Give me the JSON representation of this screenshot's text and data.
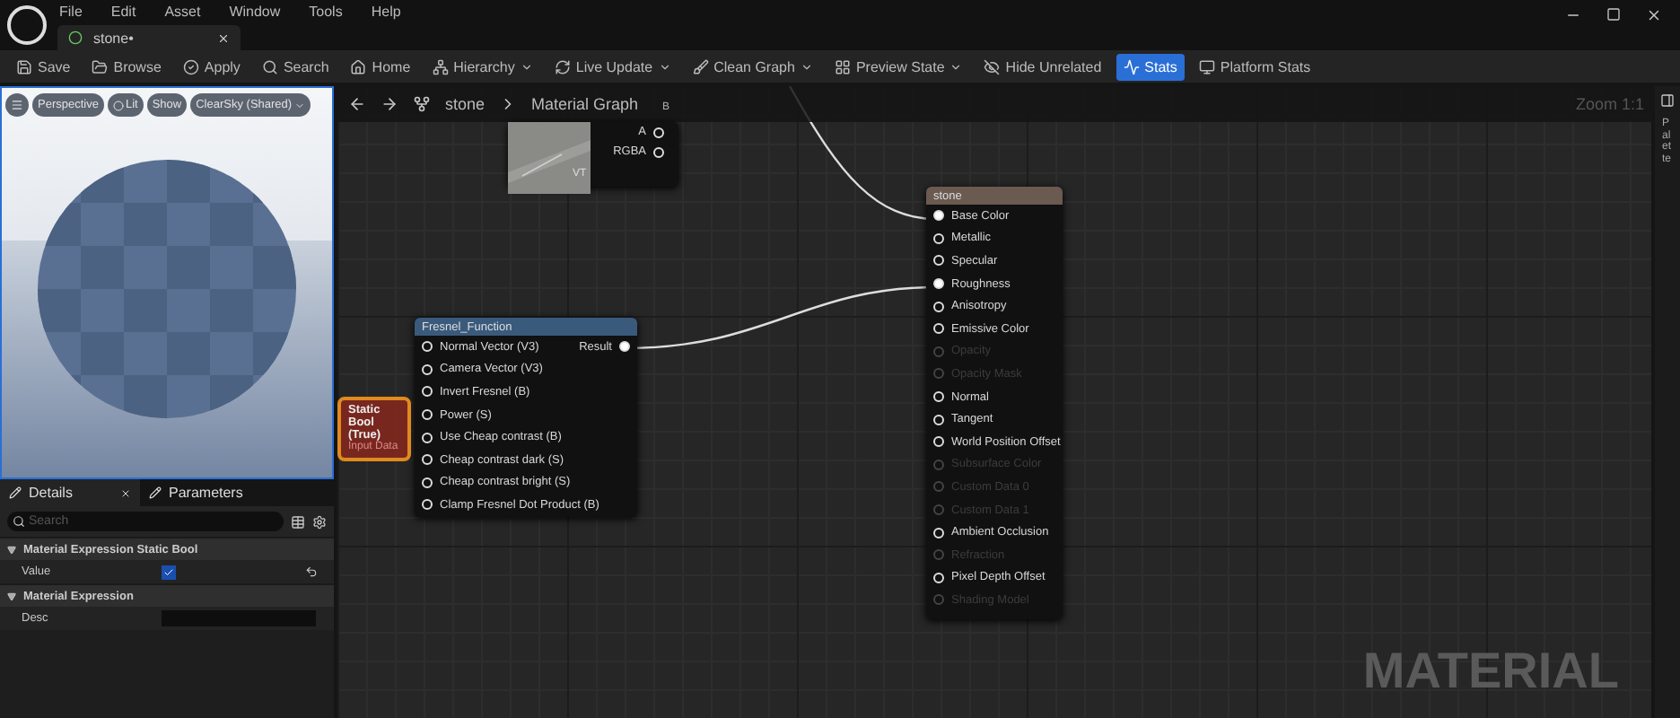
{
  "menu": [
    "File",
    "Edit",
    "Asset",
    "Window",
    "Tools",
    "Help"
  ],
  "document_tab": {
    "label": "stone•"
  },
  "toolbar": [
    {
      "label": "Save",
      "kind": "button",
      "selected": false
    },
    {
      "label": "Browse",
      "kind": "button",
      "selected": false
    },
    {
      "label": "Apply",
      "kind": "button",
      "selected": false
    },
    {
      "label": "Search",
      "kind": "button",
      "selected": false
    },
    {
      "label": "Home",
      "kind": "button",
      "selected": false
    },
    {
      "label": "Hierarchy",
      "kind": "dropdown",
      "selected": false
    },
    {
      "label": "Live Update",
      "kind": "dropdown",
      "selected": false
    },
    {
      "label": "Clean Graph",
      "kind": "dropdown",
      "selected": false
    },
    {
      "label": "Preview State",
      "kind": "dropdown",
      "selected": false
    },
    {
      "label": "Hide Unrelated",
      "kind": "button",
      "selected": false
    },
    {
      "label": "Stats",
      "kind": "button",
      "selected": true
    },
    {
      "label": "Platform Stats",
      "kind": "button",
      "selected": false
    }
  ],
  "viewport": {
    "buttons": [
      "Perspective",
      "Lit",
      "Show",
      "ClearSky (Shared)"
    ]
  },
  "details": {
    "tabs": [
      {
        "label": "Details",
        "selected": true
      },
      {
        "label": "Parameters",
        "selected": false
      }
    ],
    "search": {
      "placeholder": "Search"
    },
    "sections": [
      {
        "title": "Material Expression Static Bool",
        "expanded": true,
        "rows": [
          {
            "label": "Value",
            "kind": "checkbox",
            "checked": true
          }
        ]
      },
      {
        "title": "Material Expression",
        "expanded": true,
        "rows": [
          {
            "label": "Desc",
            "kind": "text"
          }
        ]
      }
    ]
  },
  "graph": {
    "breadcrumb": [
      "stone",
      "Material Graph"
    ],
    "zoom": "Zoom 1:1",
    "side_tab": "Palette",
    "texture_node": {
      "pins": [
        "B",
        "A",
        "RGBA"
      ],
      "badge": "VT"
    },
    "fresnel_node": {
      "title": "Fresnel_Function",
      "output": "Result",
      "inputs": [
        "Normal Vector (V3)",
        "Camera Vector (V3)",
        "Invert Fresnel (B)",
        "Power (S)",
        "Use Cheap contrast (B)",
        "Cheap contrast dark (S)",
        "Cheap contrast bright (S)",
        "Clamp Fresnel Dot Product (B)"
      ]
    },
    "bool_node": {
      "title": "Static Bool (True)",
      "subtitle": "Input Data"
    },
    "material_node": {
      "title": "stone",
      "pins": [
        {
          "label": "Base Color",
          "connected": true,
          "disabled": false
        },
        {
          "label": "Metallic",
          "connected": false,
          "disabled": false
        },
        {
          "label": "Specular",
          "connected": false,
          "disabled": false
        },
        {
          "label": "Roughness",
          "connected": true,
          "disabled": false
        },
        {
          "label": "Anisotropy",
          "connected": false,
          "disabled": false
        },
        {
          "label": "Emissive Color",
          "connected": false,
          "disabled": false
        },
        {
          "label": "Opacity",
          "connected": false,
          "disabled": true
        },
        {
          "label": "Opacity Mask",
          "connected": false,
          "disabled": true
        },
        {
          "label": "Normal",
          "connected": false,
          "disabled": false
        },
        {
          "label": "Tangent",
          "connected": false,
          "disabled": false
        },
        {
          "label": "World Position Offset",
          "connected": false,
          "disabled": false
        },
        {
          "label": "Subsurface Color",
          "connected": false,
          "disabled": true
        },
        {
          "label": "Custom Data 0",
          "connected": false,
          "disabled": true
        },
        {
          "label": "Custom Data 1",
          "connected": false,
          "disabled": true
        },
        {
          "label": "Ambient Occlusion",
          "connected": false,
          "disabled": false
        },
        {
          "label": "Refraction",
          "connected": false,
          "disabled": true
        },
        {
          "label": "Pixel Depth Offset",
          "connected": false,
          "disabled": false
        },
        {
          "label": "Shading Model",
          "connected": false,
          "disabled": true
        }
      ]
    },
    "caption": "MATERIAL"
  }
}
